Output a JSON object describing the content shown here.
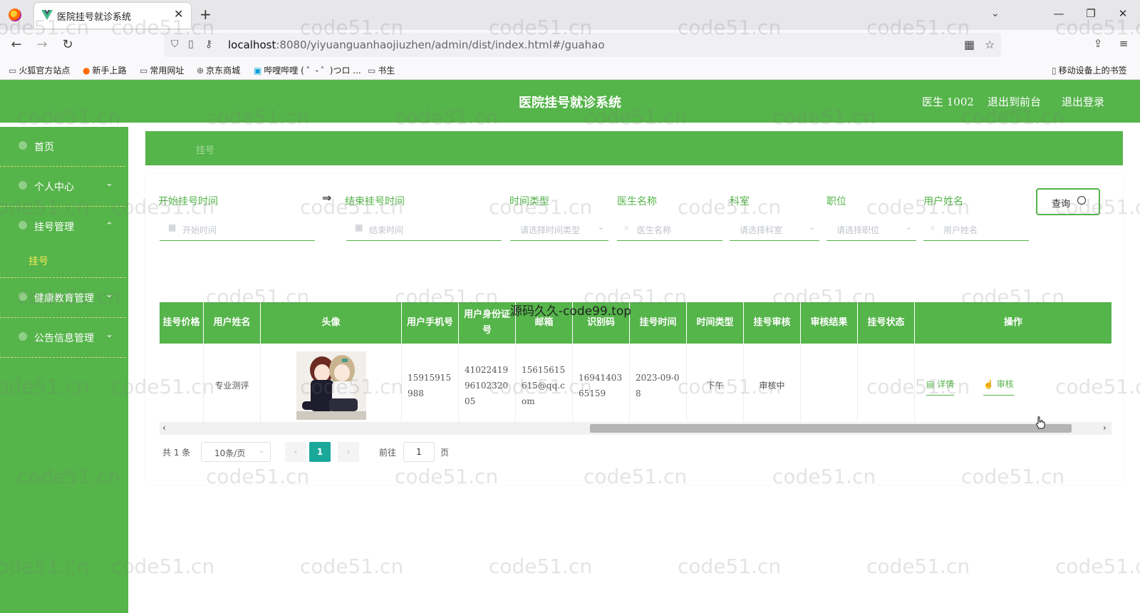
{
  "browser": {
    "tab_title": "医院挂号就诊系统",
    "url_host": "localhost",
    "url_path": ":8080/yiyuanguanhaojiuzhen/admin/dist/index.html#/guahao",
    "bookmarks": [
      "火狐官方站点",
      "新手上路",
      "常用网址",
      "京东商城",
      "哔哩哔哩 ( ゜- ゜)つロ ...",
      "书生"
    ],
    "mobile_bookmarks": "移动设备上的书签"
  },
  "app": {
    "title": "医院挂号就诊系统",
    "user": "医生 1002",
    "to_front": "退出到前台",
    "logout": "退出登录"
  },
  "sidebar": {
    "items": [
      {
        "label": "首页"
      },
      {
        "label": "个人中心"
      },
      {
        "label": "挂号管理"
      },
      {
        "label": "健康教育管理"
      },
      {
        "label": "公告信息管理"
      }
    ],
    "subitem": "挂号"
  },
  "breadcrumb": "挂号",
  "filters": {
    "start_label": "开始挂号时间",
    "start_placeholder": "开始时间",
    "end_label": "结束挂号时间",
    "end_placeholder": "结束时间",
    "time_type_label": "时间类型",
    "time_type_placeholder": "请选择时间类型",
    "doctor_label": "医生名称",
    "doctor_placeholder": "医生名称",
    "dept_label": "科室",
    "dept_placeholder": "请选择科室",
    "position_label": "职位",
    "position_placeholder": "请选择职位",
    "username_label": "用户姓名",
    "username_placeholder": "用户姓名",
    "query_button": "查询"
  },
  "table": {
    "headers": [
      "挂号价格",
      "用户姓名",
      "头像",
      "用户手机号",
      "用户身份证号",
      "邮箱",
      "识别码",
      "挂号时间",
      "时间类型",
      "挂号审核",
      "审核结果",
      "挂号状态",
      "操作"
    ],
    "rows": [
      {
        "price": "",
        "name": "专业测评",
        "phone": "15915915988",
        "idcard": "410224199610232005",
        "email": "15615615615@qq.com",
        "code": "1694140365159",
        "time": "2023-09-08",
        "time_type": "下午",
        "audit": "审核中",
        "audit_result": "",
        "status": "",
        "op_detail": "详情",
        "op_audit": "审核"
      }
    ]
  },
  "pagination": {
    "total": "共 1 条",
    "page_size": "10条/页",
    "current": "1",
    "goto_prefix": "前往",
    "goto_value": "1",
    "goto_suffix": "页"
  },
  "overlay_text": "源码久久-code99.top",
  "watermark": "code51.cn",
  "colors": {
    "primary": "#55b44a",
    "active_page": "#1aa89b",
    "submenu_active": "#f3e95a"
  }
}
